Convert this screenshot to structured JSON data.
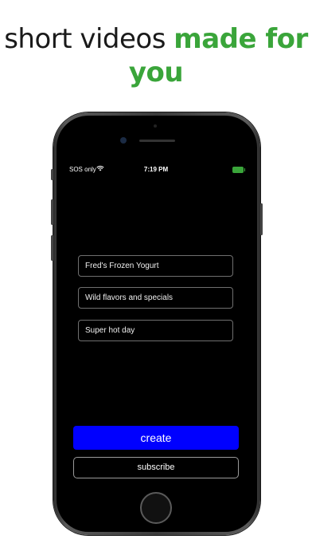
{
  "headline": {
    "plain": "short videos ",
    "accent": "made for you"
  },
  "status_bar": {
    "carrier": "SOS only",
    "time": "7:19 PM"
  },
  "form": {
    "business_name": "Fred's Frozen Yogurt",
    "tagline": "Wild flavors and specials",
    "detail": "Super hot day"
  },
  "buttons": {
    "create": "create",
    "subscribe": "subscribe"
  },
  "colors": {
    "accent": "#3aa53a",
    "primary_button": "#0000ff",
    "screen_bg": "#000000"
  },
  "icons": {
    "wifi": "wifi-icon",
    "battery": "battery-charging-icon"
  }
}
